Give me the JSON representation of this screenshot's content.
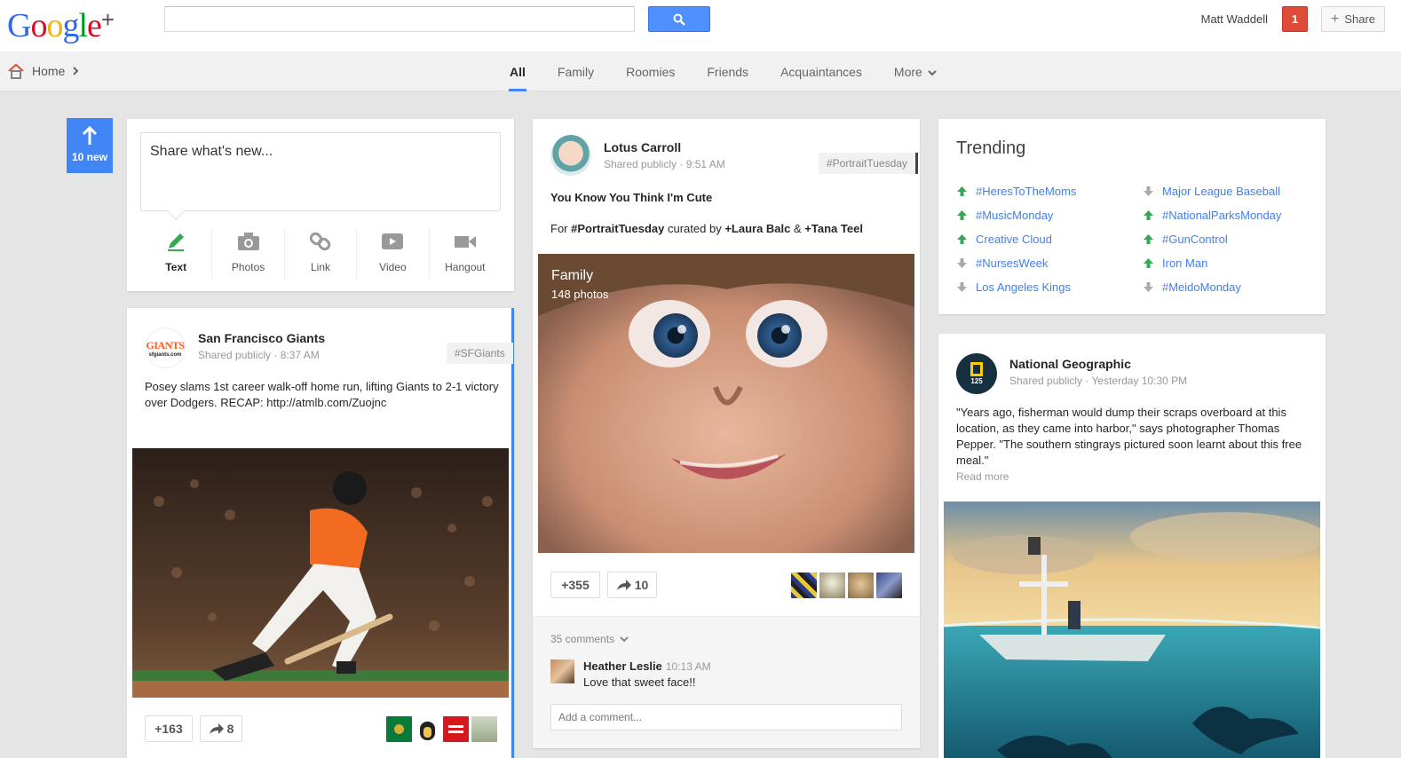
{
  "app": {
    "title": "Google+"
  },
  "header": {
    "search_placeholder": "",
    "user_name": "Matt Waddell",
    "notification_count": "1",
    "share_label": "Share"
  },
  "nav": {
    "home_label": "Home",
    "tabs": [
      {
        "label": "All",
        "active": true
      },
      {
        "label": "Family"
      },
      {
        "label": "Roomies"
      },
      {
        "label": "Friends"
      },
      {
        "label": "Acquaintances"
      },
      {
        "label": "More"
      }
    ]
  },
  "stream": {
    "new_count": "10 new"
  },
  "share_box": {
    "placeholder": "Share what's new...",
    "actions": [
      {
        "label": "Text",
        "icon": "pencil-icon"
      },
      {
        "label": "Photos",
        "icon": "camera-icon"
      },
      {
        "label": "Link",
        "icon": "link-icon"
      },
      {
        "label": "Video",
        "icon": "video-icon"
      },
      {
        "label": "Hangout",
        "icon": "hangout-camera-icon"
      }
    ]
  },
  "posts": {
    "sf": {
      "author": "San Francisco Giants",
      "meta": "Shared publicly  ·  8:37 AM",
      "tag": "#SFGiants",
      "text": "Posey slams 1st career walk-off home run, lifting Giants to 2-1 victory over Dodgers. RECAP: http://atmlb.com/Zuojnc",
      "plus_count": "+163",
      "share_count": "8",
      "logo_text_1": "GIANTS",
      "logo_text_2": "sfgiants.com"
    },
    "lotus": {
      "author": "Lotus Carroll",
      "meta": "Shared publicly  ·  9:51 AM",
      "tag": "#PortraitTuesday",
      "title": "You Know You Think I'm Cute",
      "line_prefix": "For ",
      "line_tag": "#PortraitTuesday",
      "line_mid": " curated by ",
      "line_user1": "+Laura Balc",
      "line_amp": " & ",
      "line_user2": "+Tana Teel",
      "album_name": "Family",
      "album_count": "148 photos",
      "plus_count": "+355",
      "share_count": "10",
      "comments_count": "35 comments",
      "comment": {
        "author": "Heather Leslie",
        "time": "10:13 AM",
        "text": "Love that sweet face!!"
      },
      "add_comment_placeholder": "Add a comment..."
    },
    "natgeo": {
      "author": "National Geographic",
      "meta": "Shared publicly  ·  Yesterday 10:30 PM",
      "text": "\"Years ago, fisherman would dump their scraps overboard at this location, as they came into harbor,\" says photographer Thomas Pepper. \"The southern stingrays pictured soon learnt about this free meal.\"",
      "read_more": "Read more",
      "logo_text": "125"
    }
  },
  "trending": {
    "title": "Trending",
    "left": [
      {
        "label": "#HeresToTheMoms",
        "direction": "up"
      },
      {
        "label": "#MusicMonday",
        "direction": "up"
      },
      {
        "label": "Creative Cloud",
        "direction": "up"
      },
      {
        "label": "#NursesWeek",
        "direction": "down"
      },
      {
        "label": "Los Angeles Kings",
        "direction": "down"
      }
    ],
    "right": [
      {
        "label": "Major League Baseball",
        "direction": "down"
      },
      {
        "label": "#NationalParksMonday",
        "direction": "up"
      },
      {
        "label": "#GunControl",
        "direction": "up"
      },
      {
        "label": "Iron Man",
        "direction": "up"
      },
      {
        "label": "#MeidoMonday",
        "direction": "down"
      }
    ]
  },
  "colors": {
    "accent": "#4285f4",
    "up": "#34a853",
    "down": "#aaaaaa",
    "link": "#427fed",
    "notification": "#dd4b39"
  }
}
